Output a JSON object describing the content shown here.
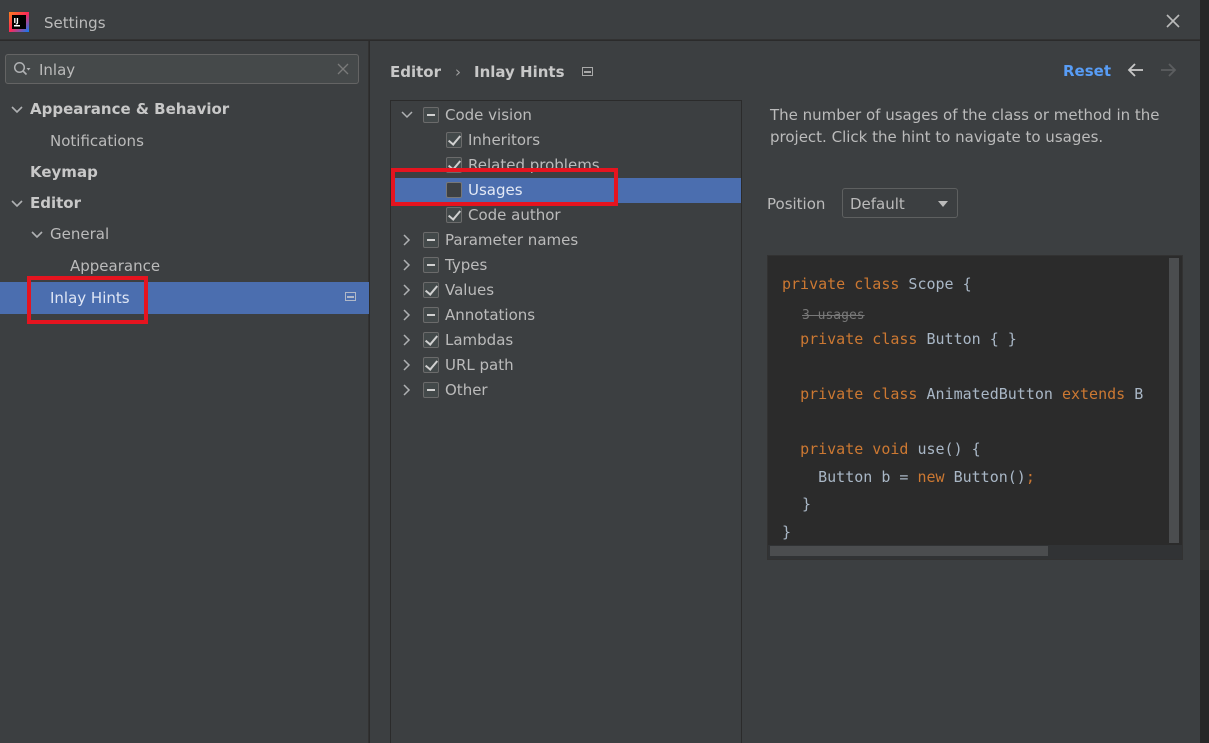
{
  "window": {
    "title": "Settings"
  },
  "search": {
    "value": "Inlay"
  },
  "sidebar": {
    "items": [
      {
        "label": "Appearance & Behavior"
      },
      {
        "label": "Notifications"
      },
      {
        "label": "Keymap"
      },
      {
        "label": "Editor"
      },
      {
        "label": "General"
      },
      {
        "label": "Appearance"
      },
      {
        "label": "Inlay Hints"
      }
    ]
  },
  "breadcrumb": {
    "parent": "Editor",
    "separator": "›",
    "current": "Inlay Hints"
  },
  "toolbar": {
    "reset_label": "Reset"
  },
  "hints_tree": {
    "items": [
      {
        "label": "Code vision",
        "state": "partial",
        "expanded": true
      },
      {
        "label": "Inheritors",
        "state": "checked"
      },
      {
        "label": "Related problems",
        "state": "checked"
      },
      {
        "label": "Usages",
        "state": "unchecked",
        "selected": true
      },
      {
        "label": "Code author",
        "state": "checked"
      },
      {
        "label": "Parameter names",
        "state": "partial"
      },
      {
        "label": "Types",
        "state": "partial"
      },
      {
        "label": "Values",
        "state": "checked"
      },
      {
        "label": "Annotations",
        "state": "partial"
      },
      {
        "label": "Lambdas",
        "state": "checked"
      },
      {
        "label": "URL path",
        "state": "checked"
      },
      {
        "label": "Other",
        "state": "partial"
      }
    ]
  },
  "details": {
    "description": "The number of usages of the class or method in the project. Click the hint to navigate to usages.",
    "position_label": "Position",
    "position_value": "Default"
  },
  "code": {
    "l1_kw": "private class",
    "l1_rest": " Scope {",
    "hint": "3 usages",
    "l2_kw": "private class",
    "l2_rest": " Button { }",
    "l3_kw": "private class",
    "l3_rest": " AnimatedButton ",
    "l3_kw2": "extends",
    "l3_tail": " B",
    "l4_kw": "private void",
    "l4_rest": " use() {",
    "l5_pre": "Button b = ",
    "l5_kw": "new",
    "l5_rest": " Button()",
    "l5_semi": ";",
    "l6": "}",
    "l7": "}"
  },
  "colors": {
    "accent": "#4b6eaf",
    "link": "#589df6",
    "keyword": "#cc7832",
    "highlight_box": "#e5141f"
  }
}
